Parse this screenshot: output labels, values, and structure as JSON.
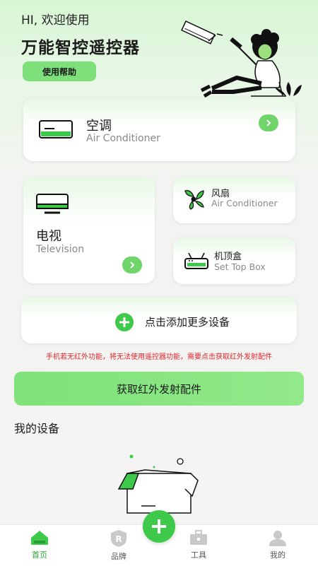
{
  "header": {
    "greeting": "HI, 欢迎使用",
    "title": "万能智控遥控器",
    "help_label": "使用帮助"
  },
  "devices": {
    "ac": {
      "name": "空调",
      "subtitle": "Air Conditioner",
      "icon": "air-conditioner-icon"
    },
    "tv": {
      "name": "电视",
      "subtitle": "Television",
      "icon": "tv-icon"
    },
    "fan": {
      "name": "风扇",
      "subtitle": "Air Conditioner",
      "icon": "fan-icon"
    },
    "stb": {
      "name": "机顶盒",
      "subtitle": "Set Top Box",
      "icon": "set-top-box-icon"
    },
    "add_more": "点击添加更多设备"
  },
  "warning": "手机若无红外功能，将无法使用遥控器功能，需要点击获取红外发射配件",
  "get_accessory_label": "获取红外发射配件",
  "my_devices_title": "我的设备",
  "nav": {
    "items": [
      {
        "label": "首页",
        "icon": "home-icon"
      },
      {
        "label": "品牌",
        "icon": "brand-shield-icon"
      },
      {
        "label": "工具",
        "icon": "toolbox-icon"
      },
      {
        "label": "我的",
        "icon": "profile-icon"
      }
    ]
  },
  "colors": {
    "accent": "#6fd56a",
    "nav_active": "#2fa935",
    "warning": "#e0262d"
  }
}
